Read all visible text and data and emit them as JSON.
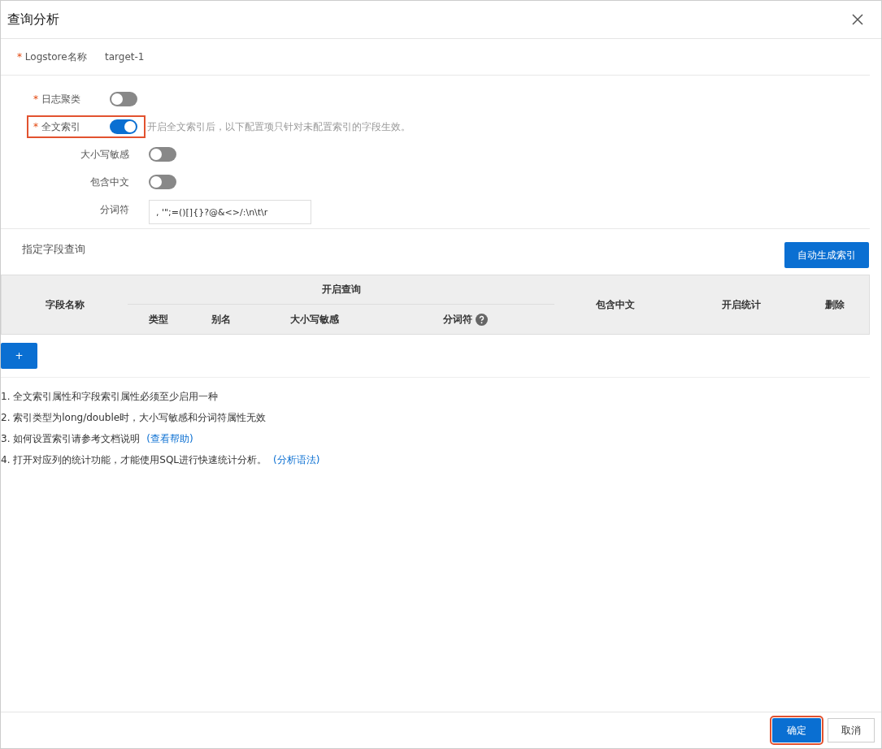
{
  "dialog": {
    "title": "查询分析"
  },
  "logstore": {
    "marker": "*",
    "label": "Logstore名称",
    "value": "target-1"
  },
  "settings": [
    {
      "kind": "switch",
      "marker": "*",
      "label": "日志聚类",
      "on": false
    },
    {
      "kind": "switch",
      "marker": "*",
      "label": "全文索引",
      "on": true,
      "highlighted": true,
      "hint": "开启全文索引后，以下配置项只针对未配置索引的字段生效。",
      "children": [
        {
          "kind": "switch",
          "label": "大小写敏感",
          "on": false
        },
        {
          "kind": "switch",
          "label": "包含中文",
          "on": false
        },
        {
          "kind": "input",
          "label": "分词符",
          "value": ", '\";=()[]{}?@&<>/:\\n\\t\\r"
        }
      ]
    }
  ],
  "field_section": {
    "title": "指定字段查询",
    "auto_button": "自动生成索引"
  },
  "table": {
    "col_name": "字段名称",
    "group": "开启查询",
    "sub_columns": [
      "类型",
      "别名",
      "大小写敏感",
      "分词符"
    ],
    "col_chinese": "包含中文",
    "col_stats": "开启统计",
    "col_delete": "删除"
  },
  "add_button": "+",
  "notes": [
    {
      "text": "1. 全文索引属性和字段索引属性必须至少启用一种"
    },
    {
      "text": "2. 索引类型为long/double时，大小写敏感和分词符属性无效"
    },
    {
      "text": "3. 如何设置索引请参考文档说明",
      "link": "(查看帮助)"
    },
    {
      "text": "4. 打开对应列的统计功能，才能使用SQL进行快速统计分析。",
      "link": "(分析语法)"
    }
  ],
  "footer": [
    {
      "label": "确定",
      "kind": "primary",
      "highlighted": true
    },
    {
      "label": "取消",
      "kind": "secondary"
    }
  ]
}
